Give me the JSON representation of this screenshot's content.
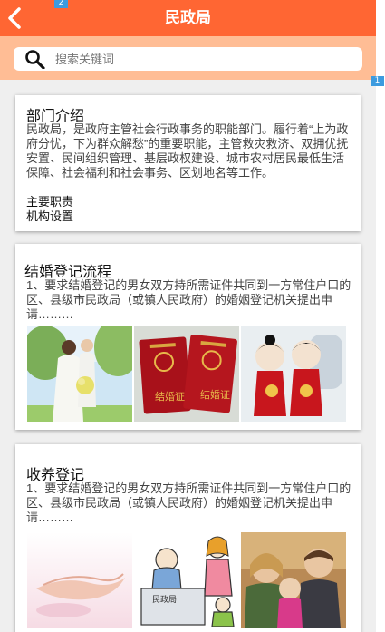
{
  "header": {
    "title": "民政局",
    "back_label": "返回"
  },
  "badges": {
    "top": "2",
    "side": "1"
  },
  "search": {
    "placeholder": "搜索关键词"
  },
  "intro": {
    "title": "部门介绍",
    "text": "民政局，是政府主管社会行政事务的职能部门。履行着“上为政府分忧，下为群众解愁”的重要职能，主管救灾救济、双拥优抚安置、民间组织管理、基层政权建设、城市农村居民最低生活保障、社会福利和社会事务、区划地名等工作。",
    "links": [
      "主要职责",
      "机构设置"
    ]
  },
  "articles": [
    {
      "title": "结婚登记流程",
      "text": "1、要求结婚登记的男女双方持所需证件共同到一方常住户口的区、县级市民政局（或镇人民政府）的婚姻登记机关提出申请………",
      "images": [
        "wedding-couple-photo",
        "marriage-certificates-photo",
        "wedding-dolls-photo"
      ],
      "cert_label": "结婚证"
    },
    {
      "title": "收养登记",
      "text": "1、要求结婚登记的男女双方持所需证件共同到一方常住户口的区、县级市民政局（或镇人民政府）的婚姻登记机关提出申请………",
      "images": [
        "caring-hands-photo",
        "civil-affairs-office-illustration",
        "family-photo"
      ],
      "office_label": "民政局"
    }
  ],
  "colors": {
    "header": "#ff6633",
    "search_bar": "#ffbd95",
    "badge": "#3c9bdf",
    "background": "#efefef"
  }
}
